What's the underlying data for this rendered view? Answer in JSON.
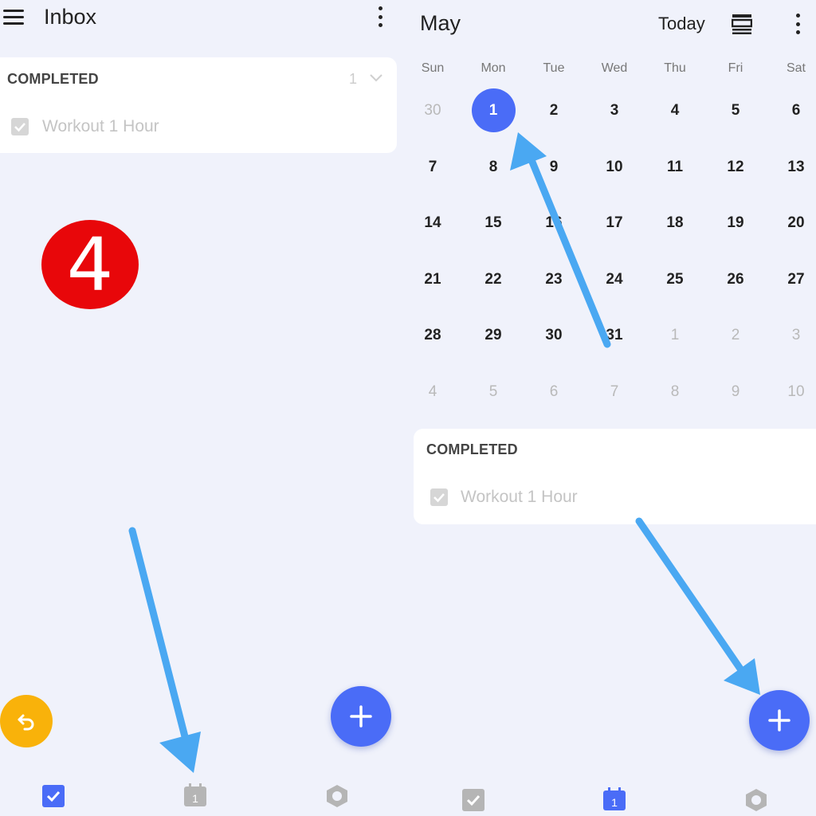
{
  "left": {
    "title": "Inbox",
    "section_label": "COMPLETED",
    "section_count": "1",
    "task": "Workout 1 Hour",
    "step_badge": "4"
  },
  "right": {
    "month": "May",
    "today_label": "Today",
    "weekdays": [
      "Sun",
      "Mon",
      "Tue",
      "Wed",
      "Thu",
      "Fri",
      "Sat"
    ],
    "weeks": [
      [
        "30",
        "1",
        "2",
        "3",
        "4",
        "5",
        "6"
      ],
      [
        "7",
        "8",
        "9",
        "10",
        "11",
        "12",
        "13"
      ],
      [
        "14",
        "15",
        "16",
        "17",
        "18",
        "19",
        "20"
      ],
      [
        "21",
        "22",
        "23",
        "24",
        "25",
        "26",
        "27"
      ],
      [
        "28",
        "29",
        "30",
        "31",
        "1",
        "2",
        "3"
      ],
      [
        "4",
        "5",
        "6",
        "7",
        "8",
        "9",
        "10"
      ]
    ],
    "selected_day": "1",
    "section_label": "COMPLETED",
    "task": "Workout 1 Hour",
    "calendar_nav_day": "1"
  },
  "colors": {
    "accent": "#4a6cf7",
    "badge_red": "#e8070a",
    "undo_yellow": "#f9b20a",
    "arrow_blue": "#4aa8f2"
  },
  "icons": [
    "menu-icon",
    "more-vert-icon",
    "chevron-down-icon",
    "checkbox-icon",
    "undo-icon",
    "plus-icon",
    "tasks-tab-icon",
    "calendar-tab-icon",
    "settings-tab-icon",
    "calendar-view-icon"
  ]
}
